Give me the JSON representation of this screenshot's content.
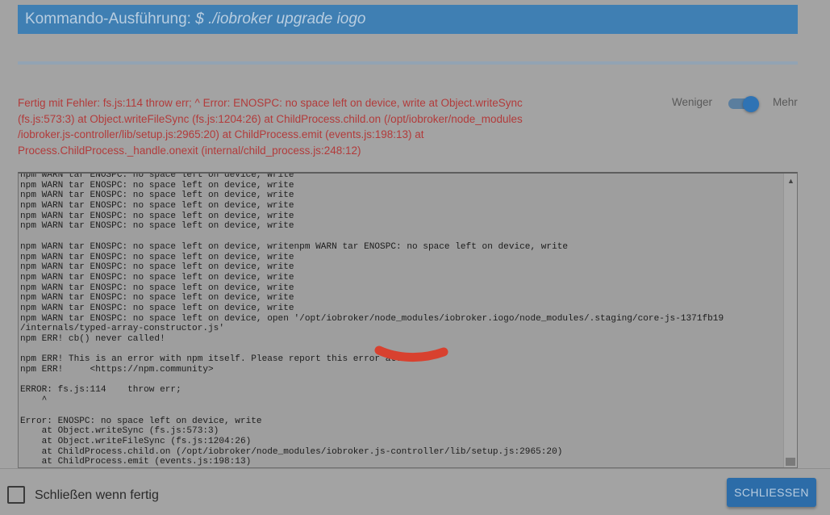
{
  "dialog": {
    "title_prefix": "Kommando-Ausführung:",
    "title_command": "$ ./iobroker upgrade iogo"
  },
  "status": {
    "error_message": "Fertig mit Fehler: fs.js:114 throw err; ^ Error: ENOSPC: no space left on device, write at Object.writeSync (fs.js:573:3) at Object.writeFileSync (fs.js:1204:26) at ChildProcess.child.on (/opt/iobroker/node_modules /iobroker.js-controller/lib/setup.js:2965:20) at ChildProcess.emit (events.js:198:13) at Process.ChildProcess._handle.onexit (internal/child_process.js:248:12)"
  },
  "toggle": {
    "less_label": "Weniger",
    "more_label": "Mehr",
    "state": "Mehr"
  },
  "log": {
    "lines": [
      "npm WARN tar ENOSPC: no space left on device, write",
      "npm WARN tar ENOSPC: no space left on device, write",
      "npm WARN tar ENOSPC: no space left on device, write",
      "npm WARN tar ENOSPC: no space left on device, write",
      "npm WARN tar ENOSPC: no space left on device, write",
      "npm WARN tar ENOSPC: no space left on device, write",
      "",
      "npm WARN tar ENOSPC: no space left on device, writenpm WARN tar ENOSPC: no space left on device, write",
      "npm WARN tar ENOSPC: no space left on device, write",
      "npm WARN tar ENOSPC: no space left on device, write",
      "npm WARN tar ENOSPC: no space left on device, write",
      "npm WARN tar ENOSPC: no space left on device, write",
      "npm WARN tar ENOSPC: no space left on device, write",
      "npm WARN tar ENOSPC: no space left on device, write",
      "npm WARN tar ENOSPC: no space left on device, open '/opt/iobroker/node_modules/iobroker.iogo/node_modules/.staging/core-js-1371fb19",
      "/internals/typed-array-constructor.js'",
      "npm ERR! cb() never called!",
      "",
      "npm ERR! This is an error with npm itself. Please report this error at:",
      "npm ERR!     <https://npm.community>",
      "",
      "ERROR: fs.js:114    throw err;",
      "    ^",
      "",
      "Error: ENOSPC: no space left on device, write",
      "    at Object.writeSync (fs.js:573:3)",
      "    at Object.writeFileSync (fs.js:1204:26)",
      "    at ChildProcess.child.on (/opt/iobroker/node_modules/iobroker.js-controller/lib/setup.js:2965:20)",
      "    at ChildProcess.emit (events.js:198:13)"
    ]
  },
  "footer": {
    "close_when_done_label": "Schließen wenn fertig",
    "close_when_done_checked": false,
    "close_button_label": "SCHLIESSEN"
  },
  "colors": {
    "title_bar": "#3f7fb3",
    "error_text": "#b23b3b",
    "button": "#2c6ca8",
    "redaction_mark": "#d8412f"
  },
  "icons": {
    "scroll_up": "triangle-up-icon"
  }
}
